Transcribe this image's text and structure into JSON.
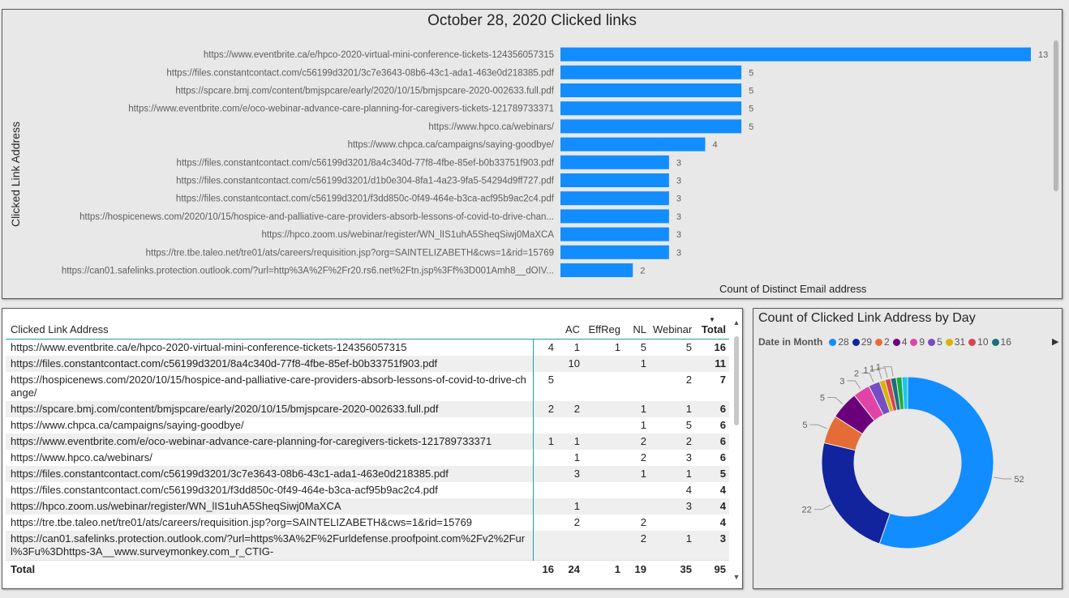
{
  "bar_panel": {
    "title": "October 28, 2020 Clicked links",
    "y_axis_title": "Clicked Link Address",
    "x_axis_title": "Count of Distinct Email address"
  },
  "table_panel": {
    "columns": [
      "Clicked Link Address",
      "AC",
      "EffReg",
      "NL",
      "Webinar",
      "Total"
    ],
    "rows": [
      {
        "link": "https://www.eventbrite.ca/e/hpco-2020-virtual-mini-conference-tickets-124356057315",
        "c0": "4",
        "ac": "1",
        "effreg": "1",
        "nl": "5",
        "webinar": "5",
        "total": "16"
      },
      {
        "link": "https://files.constantcontact.com/c56199d3201/8a4c340d-77f8-4fbe-85ef-b0b33751f903.pdf",
        "c0": "",
        "ac": "10",
        "effreg": "",
        "nl": "1",
        "webinar": "",
        "total": "11"
      },
      {
        "link": "https://hospicenews.com/2020/10/15/hospice-and-palliative-care-providers-absorb-lessons-of-covid-to-drive-change/",
        "c0": "5",
        "ac": "",
        "effreg": "",
        "nl": "",
        "webinar": "2",
        "total": "7"
      },
      {
        "link": "https://spcare.bmj.com/content/bmjspcare/early/2020/10/15/bmjspcare-2020-002633.full.pdf",
        "c0": "2",
        "ac": "2",
        "effreg": "",
        "nl": "1",
        "webinar": "1",
        "total": "6"
      },
      {
        "link": "https://www.chpca.ca/campaigns/saying-goodbye/",
        "c0": "",
        "ac": "",
        "effreg": "",
        "nl": "1",
        "webinar": "5",
        "total": "6"
      },
      {
        "link": "https://www.eventbrite.com/e/oco-webinar-advance-care-planning-for-caregivers-tickets-121789733371",
        "c0": "1",
        "ac": "1",
        "effreg": "",
        "nl": "2",
        "webinar": "2",
        "total": "6"
      },
      {
        "link": "https://www.hpco.ca/webinars/",
        "c0": "",
        "ac": "1",
        "effreg": "",
        "nl": "2",
        "webinar": "3",
        "total": "6"
      },
      {
        "link": "https://files.constantcontact.com/c56199d3201/3c7e3643-08b6-43c1-ada1-463e0d218385.pdf",
        "c0": "",
        "ac": "3",
        "effreg": "",
        "nl": "1",
        "webinar": "1",
        "total": "5"
      },
      {
        "link": "https://files.constantcontact.com/c56199d3201/f3dd850c-0f49-464e-b3ca-acf95b9ac2c4.pdf",
        "c0": "",
        "ac": "",
        "effreg": "",
        "nl": "",
        "webinar": "4",
        "total": "4"
      },
      {
        "link": "https://hpco.zoom.us/webinar/register/WN_lIS1uhA5SheqSiwj0MaXCA",
        "c0": "",
        "ac": "1",
        "effreg": "",
        "nl": "",
        "webinar": "3",
        "total": "4"
      },
      {
        "link": "https://tre.tbe.taleo.net/tre01/ats/careers/requisition.jsp?org=SAINTELIZABETH&cws=1&rid=15769",
        "c0": "",
        "ac": "2",
        "effreg": "",
        "nl": "2",
        "webinar": "",
        "total": "4"
      },
      {
        "link": "https://can01.safelinks.protection.outlook.com/?url=https%3A%2F%2Furldefense.proofpoint.com%2Fv2%2Furl%3Fu%3Dhttps-3A__www.surveymonkey.com_r_CTIG-",
        "c0": "",
        "ac": "",
        "effreg": "",
        "nl": "2",
        "webinar": "1",
        "total": "3"
      }
    ],
    "totals": {
      "label": "Total",
      "c0": "16",
      "ac": "24",
      "effreg": "1",
      "nl": "19",
      "webinar": "35",
      "total": "95"
    }
  },
  "donut_panel": {
    "title": "Count of Clicked Link Address by Day",
    "legend_title": "Date in Month"
  },
  "chart_data": [
    {
      "type": "bar",
      "orientation": "horizontal",
      "title": "October 28, 2020 Clicked links",
      "ylabel": "Clicked Link Address",
      "xlabel": "Count of Distinct Email address",
      "categories": [
        "https://www.eventbrite.ca/e/hpco-2020-virtual-mini-conference-tickets-124356057315",
        "https://files.constantcontact.com/c56199d3201/3c7e3643-08b6-43c1-ada1-463e0d218385.pdf",
        "https://spcare.bmj.com/content/bmjspcare/early/2020/10/15/bmjspcare-2020-002633.full.pdf",
        "https://www.eventbrite.com/e/oco-webinar-advance-care-planning-for-caregivers-tickets-121789733371",
        "https://www.hpco.ca/webinars/",
        "https://www.chpca.ca/campaigns/saying-goodbye/",
        "https://files.constantcontact.com/c56199d3201/8a4c340d-77f8-4fbe-85ef-b0b33751f903.pdf",
        "https://files.constantcontact.com/c56199d3201/d1b0e304-8fa1-4a23-9fa5-54294d9ff727.pdf",
        "https://files.constantcontact.com/c56199d3201/f3dd850c-0f49-464e-b3ca-acf95b9ac2c4.pdf",
        "https://hospicenews.com/2020/10/15/hospice-and-palliative-care-providers-absorb-lessons-of-covid-to-drive-chan...",
        "https://hpco.zoom.us/webinar/register/WN_lIS1uhA5SheqSiwj0MaXCA",
        "https://tre.tbe.taleo.net/tre01/ats/careers/requisition.jsp?org=SAINTELIZABETH&cws=1&rid=15769",
        "https://can01.safelinks.protection.outlook.com/?url=http%3A%2F%2Fr20.rs6.net%2Ftn.jsp%3Ff%3D001Amh8__dOIV..."
      ],
      "values": [
        13,
        5,
        5,
        5,
        5,
        4,
        3,
        3,
        3,
        3,
        3,
        3,
        2
      ],
      "xlim": [
        0,
        13
      ],
      "bar_color": "#118DFF",
      "grid": false
    },
    {
      "type": "pie",
      "variant": "donut",
      "title": "Count of Clicked Link Address by Day",
      "legend_title": "Date in Month",
      "legend_position": "top-left",
      "slices": [
        {
          "label": "28",
          "value": 52,
          "color": "#118DFF"
        },
        {
          "label": "29",
          "value": 22,
          "color": "#12239E"
        },
        {
          "label": "2",
          "value": 5,
          "color": "#E66C37"
        },
        {
          "label": "4",
          "value": 5,
          "color": "#6B007B"
        },
        {
          "label": "9",
          "value": 3,
          "color": "#E044A7"
        },
        {
          "label": "5",
          "value": 2,
          "color": "#744EC2"
        },
        {
          "label": "31",
          "value": 1,
          "color": "#D9B300"
        },
        {
          "label": "10",
          "value": 1,
          "color": "#D64550"
        },
        {
          "label": "16",
          "value": 1,
          "color": "#197278"
        },
        {
          "label": "",
          "value": 1,
          "color": "#1AAB40"
        },
        {
          "label": "",
          "value": 1,
          "color": "#15C6F4"
        }
      ],
      "data_labels": [
        "52",
        "22",
        "5",
        "5",
        "3",
        "2",
        "1",
        "1",
        "1"
      ]
    }
  ]
}
